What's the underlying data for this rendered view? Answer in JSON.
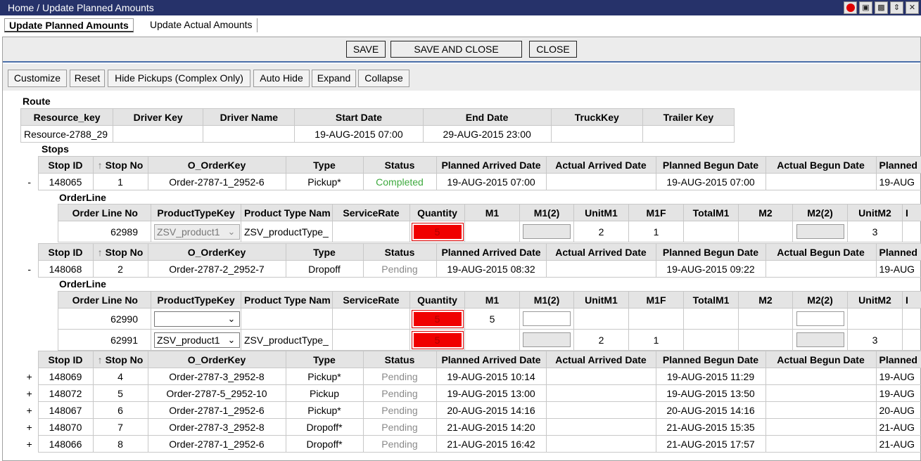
{
  "window": {
    "title": "Home / Update Planned Amounts"
  },
  "tabs": [
    "Update Planned Amounts",
    "Update Actual Amounts"
  ],
  "actions": {
    "save": "SAVE",
    "save_close": "SAVE AND CLOSE",
    "close": "CLOSE"
  },
  "toolbar": [
    "Customize",
    "Reset",
    "Hide Pickups (Complex Only)",
    "Auto Hide",
    "Expand",
    "Collapse"
  ],
  "route": {
    "label": "Route",
    "headers": [
      "Resource_key",
      "Driver Key",
      "Driver Name",
      "Start Date",
      "End Date",
      "TruckKey",
      "Trailer Key"
    ],
    "row": [
      "Resource-2788_29",
      "",
      "",
      "19-AUG-2015 07:00",
      "29-AUG-2015 23:00",
      "",
      ""
    ]
  },
  "stops_label": "Stops",
  "orderline_label": "OrderLine",
  "stop_headers": [
    "Stop ID",
    "Stop No",
    "O_OrderKey",
    "Type",
    "Status",
    "Planned Arrived Date",
    "Actual Arrived Date",
    "Planned Begun Date",
    "Actual Begun Date",
    "Planned"
  ],
  "orderline_headers": [
    "Order Line No",
    "ProductTypeKey",
    "Product Type Nam",
    "ServiceRate",
    "Quantity",
    "M1",
    "M1(2)",
    "UnitM1",
    "M1F",
    "TotalM1",
    "M2",
    "M2(2)",
    "UnitM2",
    "I"
  ],
  "stops_expanded": [
    {
      "toggle": "-",
      "row": [
        "148065",
        "1",
        "Order-2787-1_2952-6",
        "Pickup*",
        "Completed",
        "19-AUG-2015 07:00",
        "",
        "19-AUG-2015 07:00",
        "",
        "19-AUG"
      ],
      "lines": [
        {
          "no": "62989",
          "ptk": "ZSV_product1",
          "ptname": "ZSV_productType_",
          "rate": "",
          "qty": "5",
          "m1": "",
          "unitm1": "2",
          "m1f": "1",
          "unitm2": "3"
        }
      ]
    },
    {
      "toggle": "-",
      "row": [
        "148068",
        "2",
        "Order-2787-2_2952-7",
        "Dropoff",
        "Pending",
        "19-AUG-2015 08:32",
        "",
        "19-AUG-2015 09:22",
        "",
        "19-AUG"
      ],
      "lines": [
        {
          "no": "62990",
          "ptk": "",
          "ptname": "",
          "rate": "",
          "qty": "5",
          "m1": "5",
          "unitm1": "",
          "m1f": "",
          "unitm2": ""
        },
        {
          "no": "62991",
          "ptk": "ZSV_product1",
          "ptname": "ZSV_productType_",
          "rate": "",
          "qty": "5",
          "m1": "",
          "unitm1": "2",
          "m1f": "1",
          "unitm2": "3"
        }
      ]
    }
  ],
  "stops_collapsed": [
    {
      "toggle": "+",
      "row": [
        "148069",
        "4",
        "Order-2787-3_2952-8",
        "Pickup*",
        "Pending",
        "19-AUG-2015 10:14",
        "",
        "19-AUG-2015 11:29",
        "",
        "19-AUG"
      ]
    },
    {
      "toggle": "+",
      "row": [
        "148072",
        "5",
        "Order-2787-5_2952-10",
        "Pickup",
        "Pending",
        "19-AUG-2015 13:00",
        "",
        "19-AUG-2015 13:50",
        "",
        "19-AUG"
      ]
    },
    {
      "toggle": "+",
      "row": [
        "148067",
        "6",
        "Order-2787-1_2952-6",
        "Pickup*",
        "Pending",
        "20-AUG-2015 14:16",
        "",
        "20-AUG-2015 14:16",
        "",
        "20-AUG"
      ]
    },
    {
      "toggle": "+",
      "row": [
        "148070",
        "7",
        "Order-2787-3_2952-8",
        "Dropoff*",
        "Pending",
        "21-AUG-2015 14:20",
        "",
        "21-AUG-2015 15:35",
        "",
        "21-AUG"
      ]
    },
    {
      "toggle": "+",
      "row": [
        "148066",
        "8",
        "Order-2787-1_2952-6",
        "Dropoff*",
        "Pending",
        "21-AUG-2015 16:42",
        "",
        "21-AUG-2015 17:57",
        "",
        "21-AUG"
      ]
    }
  ],
  "colors": {
    "title_bar": "#26326a",
    "completed": "#3faa3f",
    "pending": "#8a8a8a",
    "quantity_alert": "#f00000"
  }
}
